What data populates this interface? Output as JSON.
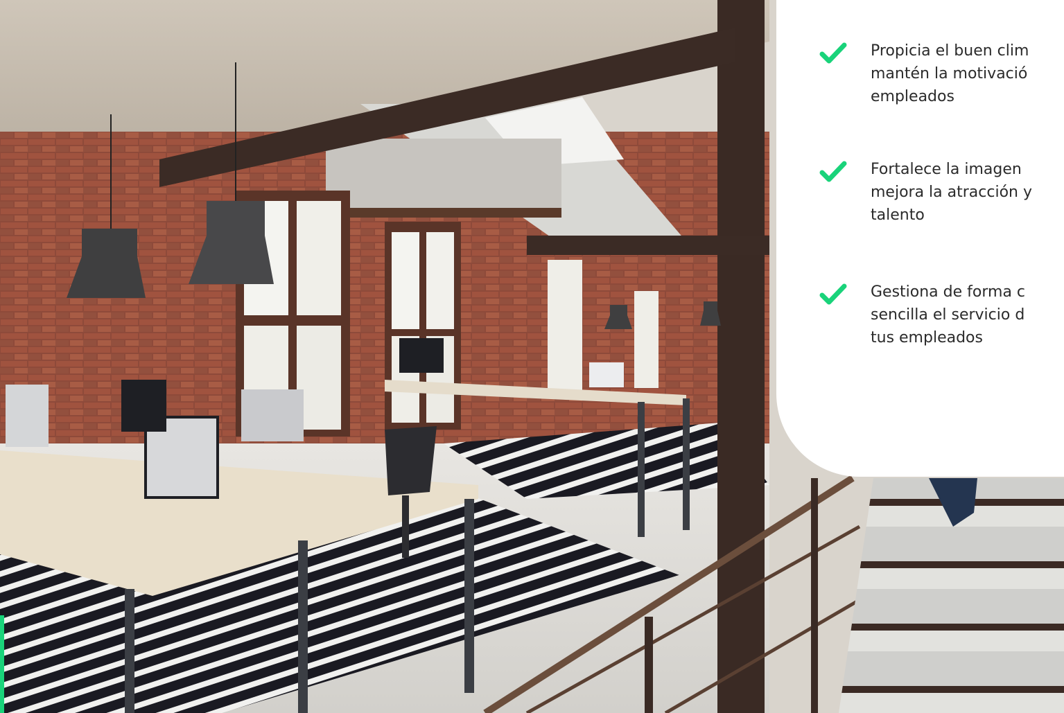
{
  "benefits": [
    {
      "text": "Propicia el buen clim\nmantén la motivació\nempleados",
      "icon": "check-icon"
    },
    {
      "text": "Fortalece la imagen \nmejora la atracción y\ntalento",
      "icon": "check-icon"
    },
    {
      "text": "Gestiona de forma c\nsencilla el servicio d\ntus empleados",
      "icon": "check-icon"
    }
  ],
  "colors": {
    "accent": "#19d37a",
    "card": "#ffffff",
    "text": "#2b2b2b"
  },
  "photo": {
    "subject": "office-photo"
  }
}
